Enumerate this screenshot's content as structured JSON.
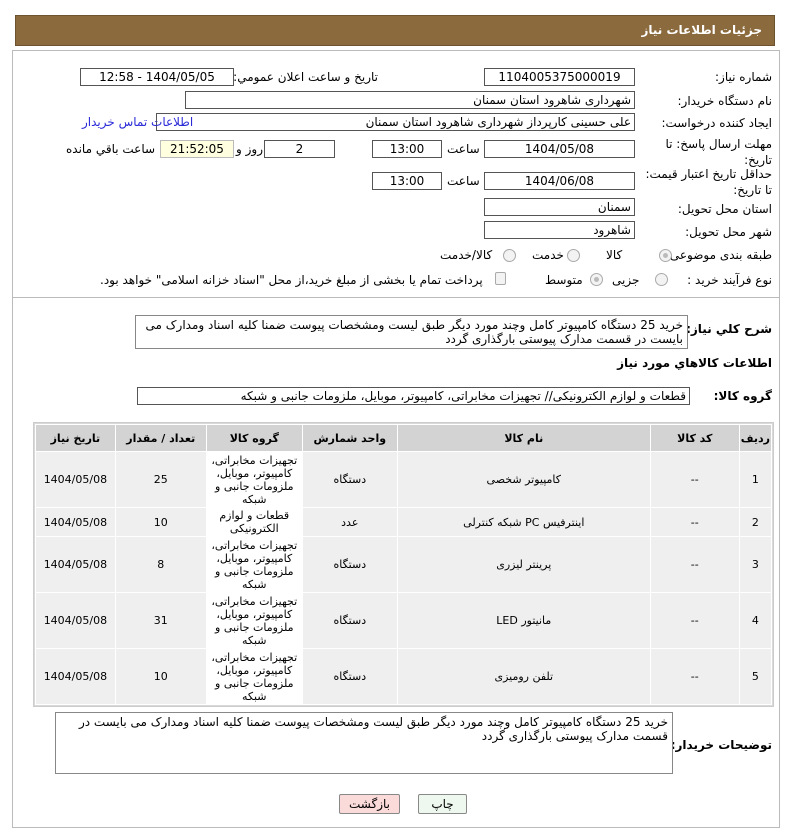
{
  "header": {
    "title": "جزئیات اطلاعات نیاز"
  },
  "form": {
    "need_number_label": "شماره نیاز:",
    "need_number": "1104005375000019",
    "announce_label": "تاريخ و ساعت اعلان عمومي:",
    "announce_value": "1404/05/05 - 12:58",
    "buyer_org_label": "نام دستگاه خريدار:",
    "buyer_org": "شهرداری شاهرود استان سمنان",
    "creator_label": "ايجاد کننده درخواست:",
    "creator": "علی حسینی کارپرداز شهرداری شاهرود استان سمنان",
    "contact_link": "اطلاعات تماس خريدار",
    "reply_deadline_label": "مهلت ارسال پاسخ: تا تاریخ:",
    "reply_date": "1404/05/08",
    "time_label": "ساعت",
    "reply_time": "13:00",
    "days": "2",
    "days_label": "روز و",
    "remaining": "21:52:05",
    "remaining_label": "ساعت باقي مانده",
    "price_validity_label": "حداقل تاریخ اعتبار قیمت: تا تاریخ:",
    "price_date": "1404/06/08",
    "price_time": "13:00",
    "province_label": "استان محل تحویل:",
    "province": "سمنان",
    "city_label": "شهر محل تحویل:",
    "city": "شاهرود",
    "category_label": "طبقه بندی موضوعی:",
    "category_options": [
      "کالا",
      "خدمت",
      "کالا/خدمت"
    ],
    "process_label": "نوع فرآیند خرید :",
    "process_options": [
      "جزیی",
      "متوسط"
    ],
    "payment_note": "پرداخت تمام یا بخشی از مبلغ خرید،از محل \"اسناد خزانه اسلامی\" خواهد بود."
  },
  "description": {
    "label": "شرح كلي نياز:",
    "text": "خرید 25 دستگاه کامپیوتر کامل وچند مورد دیگر طبق لیست ومشخصات پیوست ضمنا کلیه اسناد ومدارک می بایست در قسمت مدارک پیوستی بارگذاری گردد"
  },
  "goods": {
    "title": "اطلاعات كالاهاي مورد نياز",
    "group_label": "گروه كالا:",
    "group_value": "قطعات و لوازم الکترونیکی// تجهیزات مخابراتی، کامپیوتر، موبایل، ملزومات جانبی و شبکه"
  },
  "table": {
    "headers": [
      "ردیف",
      "کد کالا",
      "نام کالا",
      "واحد شمارش",
      "گروه کالا",
      "تعداد / مقدار",
      "تاریخ نیاز"
    ],
    "rows": [
      [
        "1",
        "--",
        "کامپیوتر شخصی",
        "دستگاه",
        "تجهیزات مخابراتی، کامپیوتر، موبایل، ملزومات جانبی و شبکه",
        "25",
        "1404/05/08"
      ],
      [
        "2",
        "--",
        "اینترفیس PC شبکه کنترلی",
        "عدد",
        "قطعات و لوازم الکترونیکی",
        "10",
        "1404/05/08"
      ],
      [
        "3",
        "--",
        "پرینتر لیزری",
        "دستگاه",
        "تجهیزات مخابراتی، کامپیوتر، موبایل، ملزومات جانبی و شبکه",
        "8",
        "1404/05/08"
      ],
      [
        "4",
        "--",
        "مانیتور LED",
        "دستگاه",
        "تجهیزات مخابراتی، کامپیوتر، موبایل، ملزومات جانبی و شبکه",
        "31",
        "1404/05/08"
      ],
      [
        "5",
        "--",
        "تلفن رومیزی",
        "دستگاه",
        "تجهیزات مخابراتی، کامپیوتر، موبایل، ملزومات جانبی و شبکه",
        "10",
        "1404/05/08"
      ]
    ]
  },
  "buyer_notes": {
    "label": "توضیحات خریدار:",
    "text": "خرید 25 دستگاه کامپیوتر کامل وچند مورد دیگر طبق لیست ومشخصات پیوست ضمنا کلیه اسناد ومدارک می بایست در قسمت مدارک پیوستی بارگذاری گردد"
  },
  "buttons": {
    "print": "چاپ",
    "back": "بازگشت"
  }
}
